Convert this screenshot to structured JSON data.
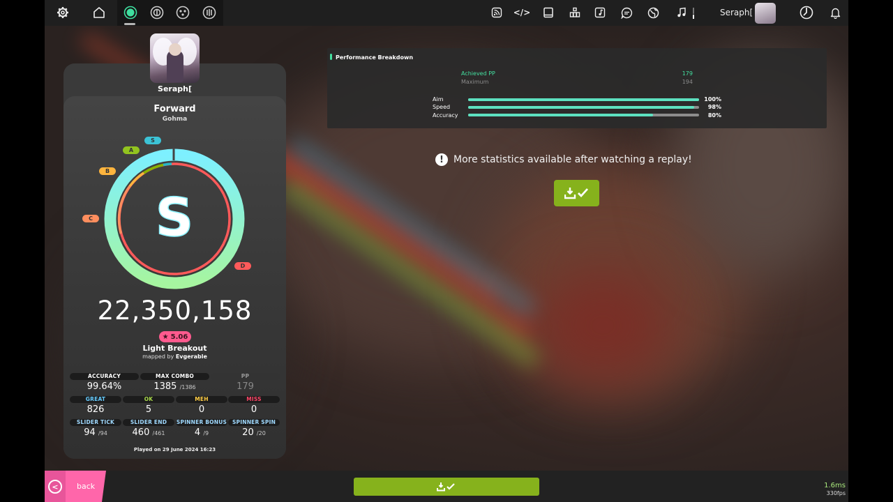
{
  "colors": {
    "accent_pink": "#ff66aa",
    "accent_green": "#86b21c",
    "bar_fill": "#5de1c0",
    "achieved_pp": "#44e0a0",
    "great": "#66ccff",
    "ok": "#a8d84a",
    "meh": "#ffcc44",
    "miss": "#ff4466"
  },
  "topbar": {
    "left_icons": [
      "gear-icon",
      "home-icon",
      "osu-ruleset-icon",
      "taiko-ruleset-icon",
      "catch-ruleset-icon",
      "mania-ruleset-icon"
    ],
    "right_icons": [
      "news-icon",
      "code-icon",
      "wiki-icon",
      "rankings-icon",
      "beatmap-listing-icon",
      "chat-icon",
      "globe-icon",
      "music-icon"
    ],
    "username": "Seraph[",
    "end_icons": [
      "clock-icon",
      "bell-icon"
    ]
  },
  "player": {
    "username": "Seraph["
  },
  "beatmap": {
    "title": "Forward",
    "artist": "Gohma",
    "difficulty": "Light Breakout",
    "mapped_by_prefix": "mapped by",
    "mapper": "Evgerable",
    "star_rating": "5.06"
  },
  "score": {
    "grade": "S",
    "total": "22,350,158",
    "accuracy_value": 0.9964,
    "grade_labels": [
      "S",
      "A",
      "B",
      "C",
      "D"
    ]
  },
  "stats": {
    "row1": [
      {
        "label": "ACCURACY",
        "value": "99.64%",
        "suffix": ""
      },
      {
        "label": "MAX COMBO",
        "value": "1385",
        "suffix": "/1386"
      },
      {
        "label": "PP",
        "value": "179",
        "suffix": ""
      }
    ],
    "row2": [
      {
        "label": "GREAT",
        "value": "826",
        "suffix": ""
      },
      {
        "label": "OK",
        "value": "5",
        "suffix": ""
      },
      {
        "label": "MEH",
        "value": "0",
        "suffix": ""
      },
      {
        "label": "MISS",
        "value": "0",
        "suffix": ""
      }
    ],
    "row3": [
      {
        "label": "SLIDER TICK",
        "value": "94",
        "suffix": "/94"
      },
      {
        "label": "SLIDER END",
        "value": "460",
        "suffix": "/461"
      },
      {
        "label": "SPINNER BONUS",
        "value": "4",
        "suffix": "/9"
      },
      {
        "label": "SPINNER SPIN",
        "value": "20",
        "suffix": "/20"
      }
    ]
  },
  "played_on": "Played on 29 June 2024 16:23",
  "performance": {
    "title": "Performance Breakdown",
    "achieved_label": "Achieved PP",
    "achieved_value": "179",
    "maximum_label": "Maximum",
    "maximum_value": "194",
    "bars": [
      {
        "label": "Aim",
        "pct": "100%",
        "value": 1.0
      },
      {
        "label": "Speed",
        "pct": "98%",
        "value": 0.98
      },
      {
        "label": "Accuracy",
        "pct": "80%",
        "value": 0.8
      }
    ]
  },
  "replay_notice": "More statistics available after watching a replay!",
  "bottom": {
    "back_label": "back"
  },
  "fps": {
    "frametime": "1.6ms",
    "framerate": "330fps"
  }
}
